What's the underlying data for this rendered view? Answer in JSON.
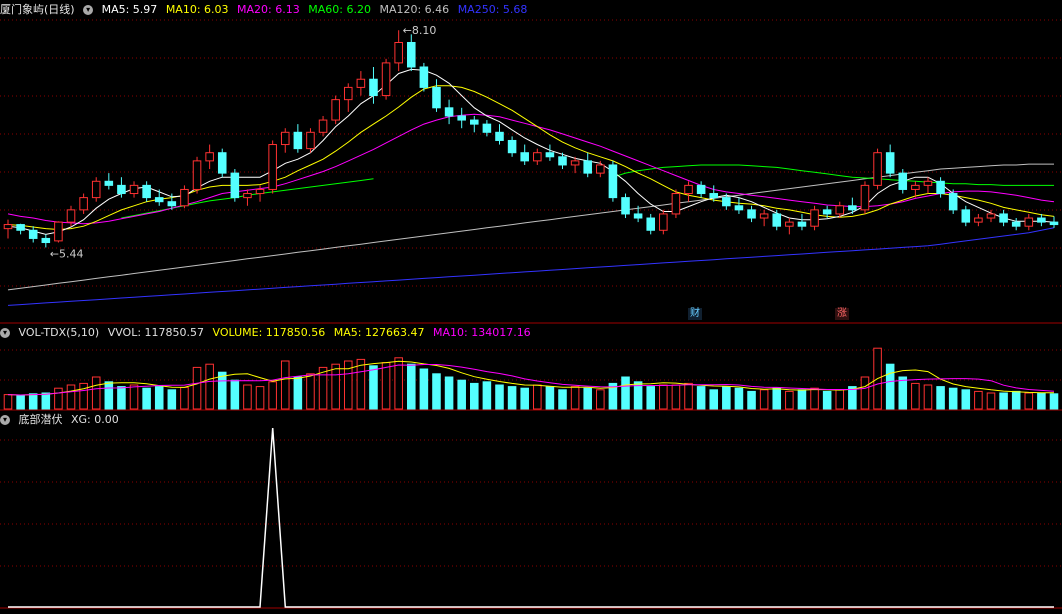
{
  "price_panel": {
    "name": "厦门象屿(日线)",
    "ma5": "MA5: 5.97",
    "ma10": "MA10: 6.03",
    "ma20": "MA20: 6.13",
    "ma60": "MA60: 6.20",
    "ma120": "MA120: 6.46",
    "ma250": "MA250: 5.68",
    "high_label": "8.10",
    "low_label": "5.44",
    "tag_cai": "财",
    "tag_zhang": "涨"
  },
  "volume_panel": {
    "title": "VOL-TDX(5,10)",
    "vvol": "VVOL: 117850.57",
    "volume": "VOLUME: 117850.56",
    "ma5": "MA5: 127663.47",
    "ma10": "MA10: 134017.16"
  },
  "indicator_panel": {
    "title": "底部潜伏",
    "xg": "XG: 0.00"
  },
  "colors": {
    "ma5": "#ffffff",
    "ma10": "#ffff00",
    "ma20": "#ff00ff",
    "ma60": "#00ff00",
    "ma120": "#c0c0c0",
    "ma250": "#3333ff",
    "up": "#ff3232",
    "down": "#54ffff",
    "grid": "#8b0000"
  },
  "chart_data": {
    "type": "candlestick",
    "candles": [
      [
        5.67,
        5.78,
        5.55,
        5.72
      ],
      [
        5.72,
        5.73,
        5.6,
        5.65
      ],
      [
        5.65,
        5.7,
        5.5,
        5.55
      ],
      [
        5.55,
        5.6,
        5.44,
        5.5
      ],
      [
        5.52,
        5.76,
        5.5,
        5.75
      ],
      [
        5.75,
        5.95,
        5.7,
        5.9
      ],
      [
        5.9,
        6.1,
        5.85,
        6.05
      ],
      [
        6.05,
        6.3,
        6.0,
        6.25
      ],
      [
        6.25,
        6.35,
        6.15,
        6.2
      ],
      [
        6.2,
        6.3,
        6.05,
        6.1
      ],
      [
        6.1,
        6.25,
        6.05,
        6.2
      ],
      [
        6.2,
        6.25,
        6.0,
        6.05
      ],
      [
        6.05,
        6.15,
        5.95,
        6.0
      ],
      [
        6.0,
        6.1,
        5.9,
        5.95
      ],
      [
        5.95,
        6.2,
        5.92,
        6.15
      ],
      [
        6.15,
        6.55,
        6.1,
        6.5
      ],
      [
        6.5,
        6.7,
        6.4,
        6.6
      ],
      [
        6.6,
        6.65,
        6.3,
        6.35
      ],
      [
        6.35,
        6.4,
        6.0,
        6.05
      ],
      [
        6.05,
        6.15,
        5.95,
        6.1
      ],
      [
        6.1,
        6.2,
        6.0,
        6.15
      ],
      [
        6.15,
        6.75,
        6.1,
        6.7
      ],
      [
        6.7,
        6.9,
        6.6,
        6.85
      ],
      [
        6.85,
        6.95,
        6.6,
        6.65
      ],
      [
        6.65,
        6.9,
        6.6,
        6.85
      ],
      [
        6.85,
        7.05,
        6.8,
        7.0
      ],
      [
        7.0,
        7.3,
        6.95,
        7.25
      ],
      [
        7.25,
        7.45,
        7.1,
        7.4
      ],
      [
        7.4,
        7.6,
        7.3,
        7.5
      ],
      [
        7.5,
        7.65,
        7.2,
        7.3
      ],
      [
        7.3,
        7.75,
        7.25,
        7.7
      ],
      [
        7.7,
        8.1,
        7.6,
        7.95
      ],
      [
        7.95,
        8.05,
        7.6,
        7.65
      ],
      [
        7.65,
        7.7,
        7.35,
        7.4
      ],
      [
        7.4,
        7.5,
        7.1,
        7.15
      ],
      [
        7.15,
        7.25,
        6.95,
        7.05
      ],
      [
        7.05,
        7.15,
        6.9,
        7.0
      ],
      [
        7.0,
        7.05,
        6.85,
        6.95
      ],
      [
        6.95,
        7.0,
        6.8,
        6.85
      ],
      [
        6.85,
        6.95,
        6.7,
        6.75
      ],
      [
        6.75,
        6.8,
        6.55,
        6.6
      ],
      [
        6.6,
        6.7,
        6.45,
        6.5
      ],
      [
        6.5,
        6.65,
        6.45,
        6.6
      ],
      [
        6.6,
        6.7,
        6.5,
        6.55
      ],
      [
        6.55,
        6.6,
        6.4,
        6.45
      ],
      [
        6.45,
        6.55,
        6.35,
        6.5
      ],
      [
        6.5,
        6.6,
        6.3,
        6.35
      ],
      [
        6.35,
        6.5,
        6.3,
        6.45
      ],
      [
        6.45,
        6.5,
        6.0,
        6.05
      ],
      [
        6.05,
        6.1,
        5.8,
        5.85
      ],
      [
        5.85,
        5.95,
        5.75,
        5.8
      ],
      [
        5.8,
        5.85,
        5.6,
        5.65
      ],
      [
        5.65,
        5.9,
        5.6,
        5.85
      ],
      [
        5.85,
        6.15,
        5.8,
        6.1
      ],
      [
        6.1,
        6.25,
        6.0,
        6.2
      ],
      [
        6.2,
        6.25,
        6.05,
        6.1
      ],
      [
        6.1,
        6.2,
        6.0,
        6.05
      ],
      [
        6.05,
        6.1,
        5.9,
        5.95
      ],
      [
        5.95,
        6.05,
        5.85,
        5.9
      ],
      [
        5.9,
        5.95,
        5.75,
        5.8
      ],
      [
        5.8,
        5.9,
        5.7,
        5.85
      ],
      [
        5.85,
        5.9,
        5.65,
        5.7
      ],
      [
        5.7,
        5.8,
        5.6,
        5.75
      ],
      [
        5.75,
        5.85,
        5.65,
        5.7
      ],
      [
        5.7,
        5.95,
        5.65,
        5.9
      ],
      [
        5.9,
        5.95,
        5.8,
        5.85
      ],
      [
        5.85,
        6.0,
        5.8,
        5.95
      ],
      [
        5.95,
        6.05,
        5.85,
        5.9
      ],
      [
        5.9,
        6.25,
        5.85,
        6.2
      ],
      [
        6.2,
        6.65,
        6.15,
        6.6
      ],
      [
        6.6,
        6.7,
        6.3,
        6.35
      ],
      [
        6.35,
        6.4,
        6.1,
        6.15
      ],
      [
        6.15,
        6.25,
        6.05,
        6.2
      ],
      [
        6.2,
        6.3,
        6.1,
        6.25
      ],
      [
        6.25,
        6.3,
        6.05,
        6.1
      ],
      [
        6.1,
        6.15,
        5.85,
        5.9
      ],
      [
        5.9,
        5.95,
        5.7,
        5.75
      ],
      [
        5.75,
        5.85,
        5.7,
        5.8
      ],
      [
        5.8,
        5.9,
        5.75,
        5.85
      ],
      [
        5.85,
        5.9,
        5.7,
        5.75
      ],
      [
        5.75,
        5.8,
        5.65,
        5.7
      ],
      [
        5.7,
        5.85,
        5.65,
        5.8
      ],
      [
        5.8,
        5.85,
        5.7,
        5.75
      ],
      [
        5.75,
        5.82,
        5.68,
        5.72
      ]
    ],
    "ma5": [
      5.7,
      5.68,
      5.64,
      5.6,
      5.63,
      5.69,
      5.78,
      5.92,
      6.03,
      6.1,
      6.16,
      6.18,
      6.12,
      6.06,
      6.07,
      6.17,
      6.25,
      6.3,
      6.3,
      6.3,
      6.3,
      6.38,
      6.47,
      6.52,
      6.6,
      6.75,
      6.92,
      7.05,
      7.2,
      7.3,
      7.43,
      7.57,
      7.62,
      7.61,
      7.55,
      7.45,
      7.3,
      7.15,
      7.05,
      6.98,
      6.88,
      6.78,
      6.7,
      6.63,
      6.58,
      6.53,
      6.5,
      6.47,
      6.37,
      6.25,
      6.1,
      5.97,
      5.88,
      5.88,
      5.94,
      6.0,
      6.05,
      6.08,
      6.05,
      6.0,
      5.93,
      5.86,
      5.8,
      5.78,
      5.78,
      5.79,
      5.82,
      5.87,
      5.95,
      6.1,
      6.2,
      6.25,
      6.3,
      6.3,
      6.22,
      6.1,
      6.0,
      5.93,
      5.86,
      5.8,
      5.76,
      5.76,
      5.76,
      5.75
    ],
    "ma10": [
      5.72,
      5.71,
      5.69,
      5.67,
      5.66,
      5.67,
      5.7,
      5.76,
      5.83,
      5.9,
      5.95,
      6.0,
      6.03,
      6.05,
      6.08,
      6.14,
      6.18,
      6.2,
      6.2,
      6.2,
      6.21,
      6.25,
      6.3,
      6.38,
      6.45,
      6.52,
      6.62,
      6.73,
      6.85,
      6.95,
      7.05,
      7.16,
      7.28,
      7.38,
      7.42,
      7.42,
      7.4,
      7.35,
      7.28,
      7.2,
      7.12,
      7.02,
      6.92,
      6.82,
      6.73,
      6.66,
      6.6,
      6.55,
      6.5,
      6.43,
      6.35,
      6.28,
      6.2,
      6.12,
      6.08,
      6.05,
      6.02,
      6.0,
      5.98,
      5.97,
      5.95,
      5.92,
      5.9,
      5.87,
      5.84,
      5.82,
      5.81,
      5.82,
      5.85,
      5.9,
      5.97,
      6.02,
      6.07,
      6.1,
      6.1,
      6.08,
      6.05,
      6.02,
      5.98,
      5.93,
      5.9,
      5.87,
      5.84,
      5.82
    ],
    "ma20": [
      5.85,
      5.82,
      5.8,
      5.77,
      5.75,
      5.74,
      5.73,
      5.74,
      5.76,
      5.79,
      5.82,
      5.85,
      5.88,
      5.92,
      5.96,
      6.0,
      6.05,
      6.1,
      6.12,
      6.14,
      6.16,
      6.18,
      6.22,
      6.27,
      6.32,
      6.37,
      6.43,
      6.5,
      6.57,
      6.64,
      6.72,
      6.8,
      6.88,
      6.95,
      7.0,
      7.04,
      7.06,
      7.07,
      7.06,
      7.04,
      7.0,
      6.96,
      6.92,
      6.88,
      6.83,
      6.78,
      6.73,
      6.68,
      6.62,
      6.56,
      6.5,
      6.44,
      6.38,
      6.32,
      6.26,
      6.2,
      6.15,
      6.12,
      6.1,
      6.08,
      6.06,
      6.04,
      6.02,
      6.0,
      5.98,
      5.96,
      5.95,
      5.94,
      5.94,
      5.95,
      5.97,
      6.0,
      6.04,
      6.07,
      6.1,
      6.12,
      6.13,
      6.13,
      6.12,
      6.1,
      6.08,
      6.05,
      6.02,
      6.0
    ],
    "ma60": [
      null,
      null,
      null,
      null,
      null,
      null,
      null,
      null,
      null,
      5.8,
      5.83,
      5.86,
      5.89,
      5.92,
      5.95,
      5.98,
      6.01,
      6.03,
      6.05,
      6.08,
      6.1,
      6.12,
      6.14,
      6.16,
      6.18,
      6.2,
      6.22,
      6.24,
      6.26,
      6.28,
      null,
      null,
      null,
      null,
      null,
      null,
      null,
      null,
      null,
      null,
      null,
      null,
      null,
      null,
      null,
      null,
      null,
      null,
      6.3,
      6.35,
      6.38,
      6.4,
      6.42,
      6.43,
      6.44,
      6.45,
      6.45,
      6.45,
      6.45,
      6.44,
      6.43,
      6.42,
      6.4,
      6.38,
      6.36,
      6.34,
      6.32,
      6.3,
      6.29,
      6.28,
      6.27,
      6.26,
      6.25,
      6.24,
      6.23,
      6.22,
      6.22,
      6.21,
      6.21,
      6.2,
      6.2,
      6.2,
      6.2,
      6.2
    ],
    "ma120": [
      4.92,
      4.94,
      4.96,
      4.98,
      5.0,
      5.02,
      5.04,
      5.06,
      5.08,
      5.1,
      5.12,
      5.14,
      5.16,
      5.18,
      5.2,
      5.22,
      5.24,
      5.26,
      5.28,
      5.3,
      5.32,
      5.34,
      5.36,
      5.38,
      5.4,
      5.42,
      5.44,
      5.46,
      5.48,
      5.5,
      5.52,
      5.54,
      5.56,
      5.58,
      5.6,
      5.62,
      5.64,
      5.66,
      5.68,
      5.7,
      5.72,
      5.74,
      5.76,
      5.78,
      5.8,
      5.82,
      5.84,
      5.86,
      5.88,
      5.9,
      5.92,
      5.94,
      5.96,
      5.98,
      6.0,
      6.02,
      6.04,
      6.06,
      6.08,
      6.1,
      6.12,
      6.14,
      6.16,
      6.18,
      6.2,
      6.22,
      6.24,
      6.26,
      6.28,
      6.3,
      6.32,
      6.34,
      6.36,
      6.38,
      6.4,
      6.41,
      6.42,
      6.43,
      6.44,
      6.45,
      6.45,
      6.46,
      6.46,
      6.46
    ],
    "ma250": [
      4.73,
      4.74,
      4.75,
      4.76,
      4.77,
      4.78,
      4.79,
      4.8,
      4.81,
      4.82,
      4.83,
      4.84,
      4.85,
      4.86,
      4.87,
      4.88,
      4.89,
      4.9,
      4.91,
      4.92,
      4.93,
      4.94,
      4.95,
      4.96,
      4.97,
      4.98,
      4.99,
      5.0,
      5.01,
      5.02,
      5.03,
      5.04,
      5.05,
      5.06,
      5.07,
      5.08,
      5.09,
      5.1,
      5.11,
      5.12,
      5.13,
      5.14,
      5.15,
      5.16,
      5.17,
      5.18,
      5.19,
      5.2,
      5.21,
      5.22,
      5.23,
      5.24,
      5.25,
      5.26,
      5.27,
      5.28,
      5.29,
      5.3,
      5.31,
      5.32,
      5.33,
      5.34,
      5.35,
      5.36,
      5.37,
      5.38,
      5.39,
      5.4,
      5.41,
      5.42,
      5.43,
      5.44,
      5.45,
      5.46,
      5.48,
      5.5,
      5.52,
      5.54,
      5.56,
      5.58,
      5.6,
      5.62,
      5.65,
      5.68
    ],
    "volumes": [
      90,
      85,
      95,
      100,
      130,
      150,
      160,
      200,
      170,
      140,
      150,
      130,
      140,
      120,
      135,
      260,
      280,
      230,
      180,
      150,
      140,
      170,
      300,
      200,
      220,
      260,
      280,
      300,
      310,
      270,
      290,
      320,
      280,
      250,
      220,
      200,
      180,
      160,
      170,
      150,
      140,
      130,
      150,
      140,
      120,
      140,
      130,
      120,
      160,
      200,
      170,
      140,
      150,
      150,
      160,
      140,
      120,
      140,
      130,
      110,
      120,
      130,
      110,
      120,
      130,
      110,
      120,
      140,
      200,
      380,
      280,
      200,
      160,
      150,
      140,
      130,
      120,
      110,
      100,
      100,
      110,
      100,
      100,
      95
    ],
    "xg": [
      0,
      0,
      0,
      0,
      0,
      0,
      0,
      0,
      0,
      0,
      0,
      0,
      0,
      0,
      0,
      0,
      0,
      0,
      0,
      0,
      0,
      1,
      0,
      0,
      0,
      0,
      0,
      0,
      0,
      0,
      0,
      0,
      0,
      0,
      0,
      0,
      0,
      0,
      0,
      0,
      0,
      0,
      0,
      0,
      0,
      0,
      0,
      0,
      0,
      0,
      0,
      0,
      0,
      0,
      0,
      0,
      0,
      0,
      0,
      0,
      0,
      0,
      0,
      0,
      0,
      0,
      0,
      0,
      0,
      0,
      0,
      0,
      0,
      0,
      0,
      0,
      0,
      0,
      0,
      0,
      0,
      0,
      0,
      0
    ]
  }
}
